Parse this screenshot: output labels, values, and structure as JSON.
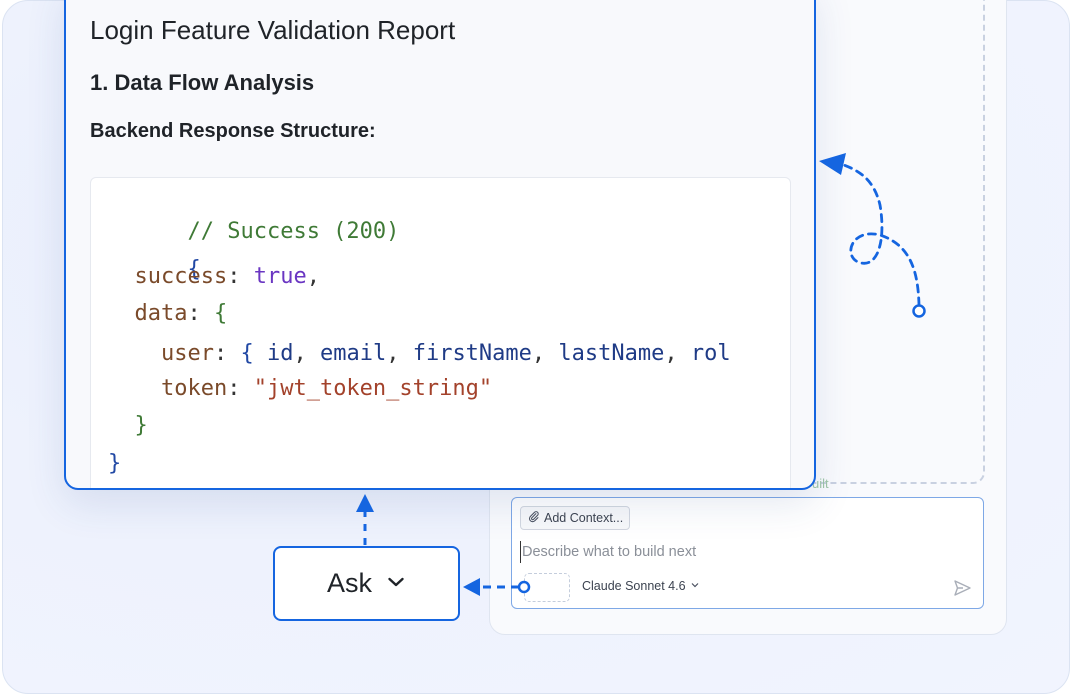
{
  "report": {
    "title": "Login Feature Validation Report",
    "section": "1. Data Flow Analysis",
    "subsection": "Backend Response Structure:"
  },
  "code": {
    "comment": "// Success (200)",
    "open_brace": "{",
    "success_key": "success",
    "success_value": "true",
    "data_key": "data",
    "user_key": "user",
    "user_fields": [
      "id",
      "email",
      "firstName",
      "lastName",
      "rol"
    ],
    "token_key": "token",
    "token_value": "\"jwt_token_string\"",
    "inner_close": "}",
    "outer_close": "}"
  },
  "chat": {
    "add_context_label": "Add Context...",
    "prompt_placeholder": "Describe what to build next",
    "model_label": "Claude Sonnet 4.6",
    "faint_label": "uilt"
  },
  "mode_dropdown": {
    "label": "Ask"
  },
  "icons": {
    "paperclip": "paperclip-icon",
    "model_chevron": "chevron-down-icon",
    "send": "send-icon",
    "ask_chevron": "chevron-down-icon"
  },
  "colors": {
    "accent": "#1565e0",
    "input_border": "#7ea8e6",
    "comment": "#3f7a36",
    "keyword_bool": "#6a36c2",
    "string": "#a3422b"
  }
}
